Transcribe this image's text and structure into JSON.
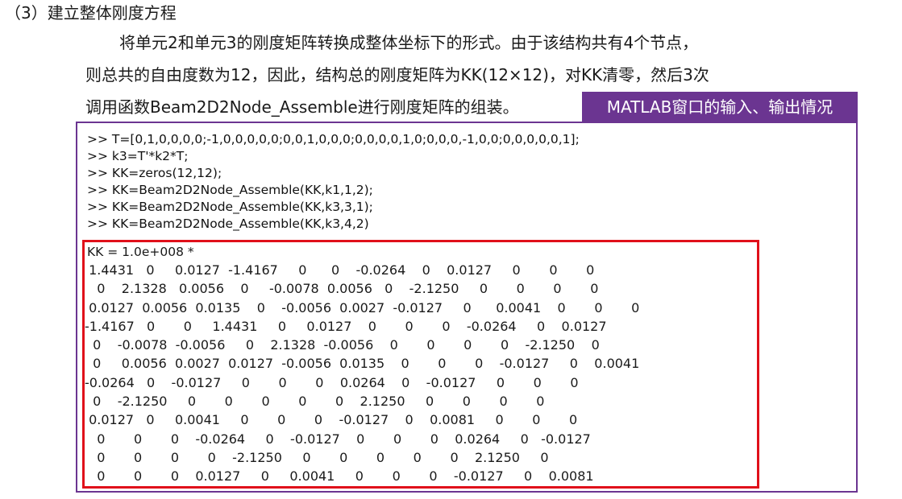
{
  "heading": "（3）建立整体刚度方程",
  "paragraph": [
    "将单元2和单元3的刚度矩阵转换成整体坐标下的形式。由于该结构共有4个节点，",
    "则总共的自由度数为12，因此，结构总的刚度矩阵为KK(12×12)，对KK清零，然后3次",
    "调用函数Beam2D2Node_Assemble进行刚度矩阵的组装。"
  ],
  "matlab_tag": "MATLAB窗口的输入、输出情况",
  "colors": {
    "tag_bg": "#6b3591",
    "console_border": "#6b3591",
    "highlight_border": "#e0101a"
  },
  "commands": [
    ">> T=[0,1,0,0,0,0;-1,0,0,0,0,0;0,0,1,0,0,0;0,0,0,0,1,0;0,0,0,-1,0,0;0,0,0,0,0,1];",
    ">> k3=T'*k2*T;",
    ">> KK=zeros(12,12);",
    ">> KK=Beam2D2Node_Assemble(KK,k1,1,2);",
    ">> KK=Beam2D2Node_Assemble(KK,k3,3,1);",
    ">> KK=Beam2D2Node_Assemble(KK,k3,4,2)"
  ],
  "kk_label": "KK = 1.0e+008 *",
  "matrix_rows": [
    " 1.4431   0     0.0127  -1.4167     0      0    -0.0264    0    0.0127     0       0       0",
    "   0    2.1328   0.0056    0     -0.0078  0.0056   0    -2.1250     0       0       0       0",
    " 0.0127  0.0056  0.0135    0    -0.0056  0.0027  -0.0127     0      0.0041    0       0       0",
    "-1.4167   0       0     1.4431     0     0.0127    0       0       0    -0.0264     0    0.0127",
    "  0    -0.0078  -0.0056     0    2.1328  -0.0056    0       0       0       0    -2.1250    0",
    "  0     0.0056  0.0027  0.0127  -0.0056  0.0135    0       0       0    -0.0127     0    0.0041",
    "-0.0264   0    -0.0127     0       0       0    0.0264    0    -0.0127     0       0       0",
    "  0    -2.1250     0       0       0       0       0    2.1250     0       0       0       0",
    " 0.0127   0     0.0041     0       0       0    -0.0127    0    0.0081     0       0       0",
    "   0       0       0    -0.0264     0    -0.0127    0       0       0    0.0264     0   -0.0127",
    "   0       0       0       0    -2.1250     0       0       0       0       0    2.1250     0",
    "   0       0       0    0.0127     0     0.0041     0       0       0    -0.0127     0    0.0081"
  ]
}
